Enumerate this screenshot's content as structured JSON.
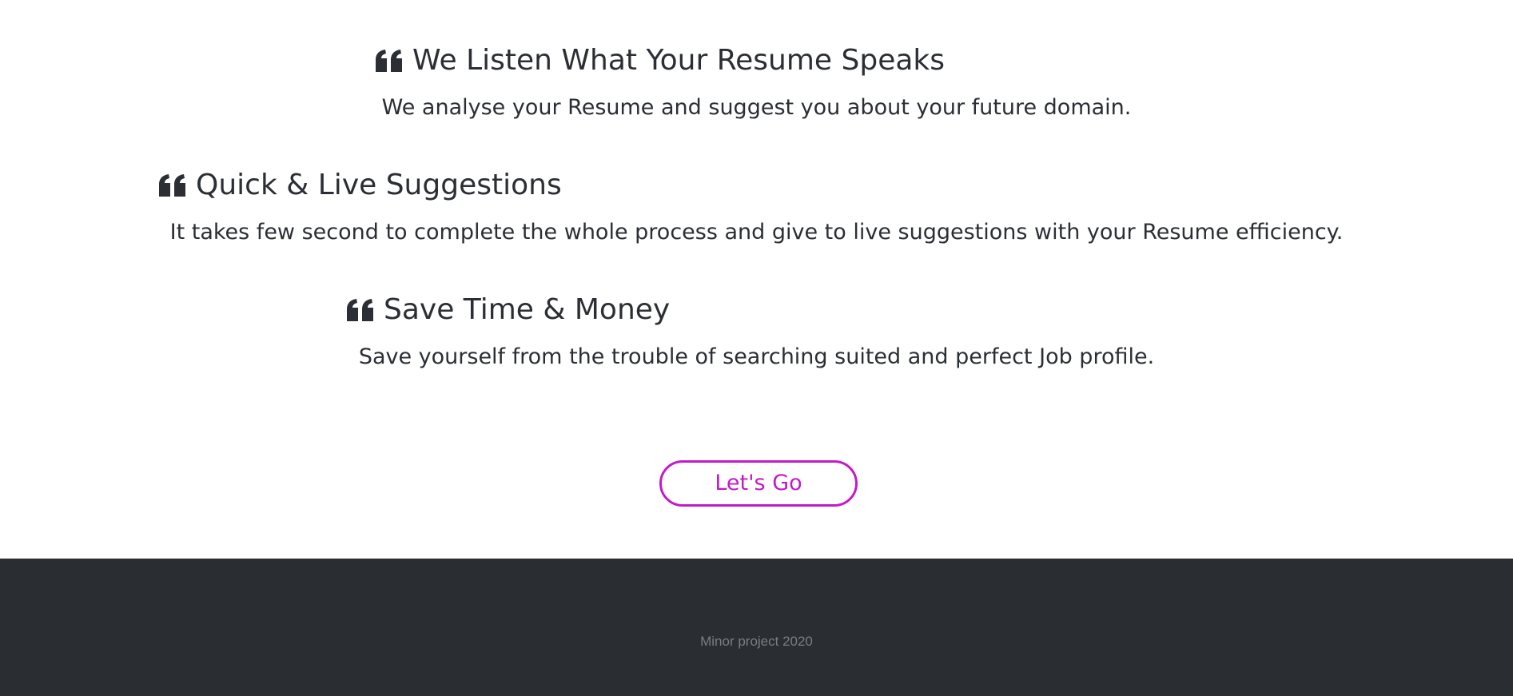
{
  "features": [
    {
      "heading": "We Listen What Your Resume Speaks",
      "text": "We analyse your Resume and suggest you about your future domain.",
      "icon": "quote-left-icon"
    },
    {
      "heading": "Quick & Live Suggestions",
      "text": "It takes few second to complete the whole process and give to live suggestions with your Resume efficiency.",
      "icon": "quote-left-icon"
    },
    {
      "heading": "Save Time & Money",
      "text": "Save yourself from the trouble of searching suited and perfect Job profile.",
      "icon": "quote-left-icon"
    }
  ],
  "cta": {
    "label": "Let's Go"
  },
  "footer": {
    "text": "Minor project 2020"
  },
  "colors": {
    "text": "#2b2f35",
    "accent": "#c21bc7",
    "footer_background": "#2a2d31",
    "footer_text": "#7a7e83",
    "page_background": "#ffffff"
  }
}
